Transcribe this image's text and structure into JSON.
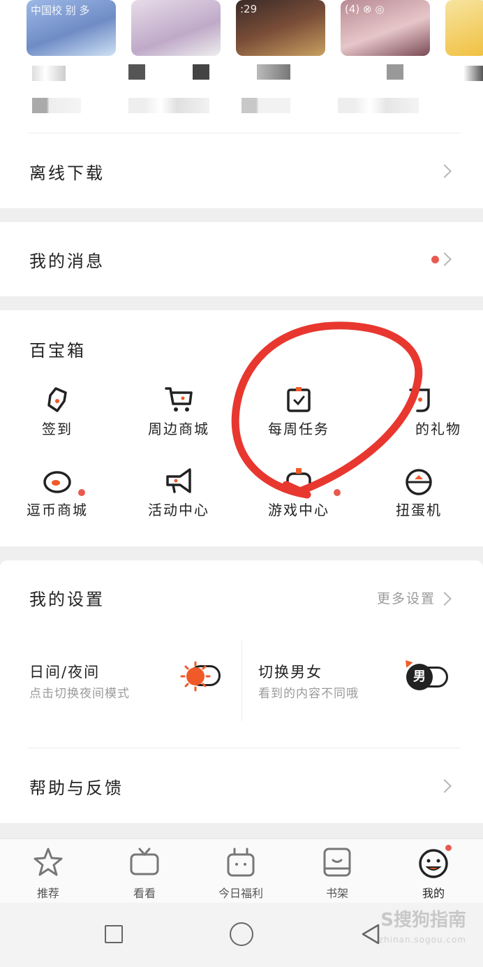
{
  "comics": {
    "covers": [
      {
        "text": "中国校 别 多",
        "bg": "#8aa8d8"
      },
      {
        "text": "",
        "bg": "#d9c7d6"
      },
      {
        "text": ":29",
        "bg": "#6b4a3c"
      },
      {
        "text": "(4) ⊗ ◎",
        "bg": "#c9a0a6"
      },
      {
        "text": "",
        "bg": "#f0d070"
      }
    ]
  },
  "offline": {
    "label": "离线下载"
  },
  "messages": {
    "label": "我的消息",
    "dot_color": "#e85a50"
  },
  "toolbox": {
    "title": "百宝箱",
    "items": [
      {
        "label": "签到",
        "icon": "pen-icon",
        "dot": true
      },
      {
        "label": "周边商城",
        "icon": "cart-icon",
        "dot": false
      },
      {
        "label": "每周任务",
        "icon": "calendar-check-icon",
        "dot": true
      },
      {
        "label": "的礼物",
        "icon": "gift-icon",
        "dot": false
      },
      {
        "label": "逗币商城",
        "icon": "egg-icon",
        "dot": false
      },
      {
        "label": "活动中心",
        "icon": "megaphone-icon",
        "dot": false
      },
      {
        "label": "游戏中心",
        "icon": "gamepad-icon",
        "dot": false
      },
      {
        "label": "扭蛋机",
        "icon": "gashapon-icon",
        "dot": false
      }
    ],
    "highlight_color": "#e8372f"
  },
  "settings": {
    "title": "我的设置",
    "more": "更多设置",
    "day_night": {
      "title": "日间/夜间",
      "sub": "点击切换夜间模式"
    },
    "gender": {
      "title": "切换男女",
      "sub": "看到的内容不同哦",
      "badge": "男"
    }
  },
  "help": {
    "label": "帮助与反馈"
  },
  "tabs": [
    {
      "label": "推荐",
      "icon": "star-icon"
    },
    {
      "label": "看看",
      "icon": "tv-icon"
    },
    {
      "label": "今日福利",
      "icon": "gift-box-icon"
    },
    {
      "label": "书架",
      "icon": "book-icon"
    },
    {
      "label": "我的",
      "icon": "face-icon"
    }
  ],
  "watermark": {
    "logo": "S搜狗指南",
    "url": "zhinan.sogou.com"
  },
  "colors": {
    "accent": "#f05a28",
    "dot": "#e85a50"
  }
}
